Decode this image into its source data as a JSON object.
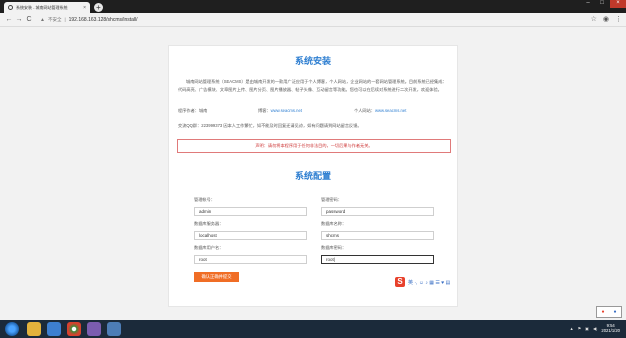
{
  "browser": {
    "tab_title": "系统安装 - 城南网站管理系统",
    "tab_close": "×",
    "new_tab": "+",
    "back": "←",
    "forward": "→",
    "reload": "C",
    "security_icon": "warning-triangle-icon",
    "security_text": "不安全",
    "url": "192.168.163.128/shcms/install/",
    "bookmark": "☆",
    "menu": "⋮",
    "win_min": "–",
    "win_max": "□",
    "win_close": "×"
  },
  "install": {
    "title": "系统安装",
    "intro": "城南网站管理系统（SEACMS）是由城南开发的一款用广泛应用于个人博客，个人网站，企业网站的一套网站管理系统。目前系统已经集成：代码高亮、广告模块、文章图片上传、图片分页、图片播放器、帖子头像、互动留言等功能。您也可以在后续对系统进行二次开发，欢迎体验。",
    "author_label": "程序作者：城南",
    "blog_label": "博客：",
    "blog_link": "www.seacms.net",
    "site_label": "个人网站：",
    "site_link": "www.seacms.net",
    "qq_line": "交流QQ群：223999373 因本人工作繁忙，如不能及时回复还请见谅，如有问题请到网站留言反馈。",
    "notice": "声明：请勿将本程序用于任何非法目的，一切后果与作者无关。"
  },
  "config": {
    "title": "系统配置",
    "admin_user_label": "管理帐号：",
    "admin_user_value": "admin",
    "admin_pass_label": "管理密码：",
    "admin_pass_value": "password",
    "db_server_label": "数据库服务器：",
    "db_server_value": "localhost",
    "db_name_label": "数据库名称：",
    "db_name_value": "shcms",
    "db_user_label": "数据库用户名：",
    "db_user_value": "root",
    "db_pass_label": "数据库密码：",
    "db_pass_value": "root|",
    "submit_label": "确认正确并提交"
  },
  "ime": {
    "logo": "S",
    "tools": "英 ·, ☺ ♪ ▦ ☰ ♥ ▤"
  },
  "taskbar": {
    "time": "9:54",
    "date": "2021/1/20"
  }
}
